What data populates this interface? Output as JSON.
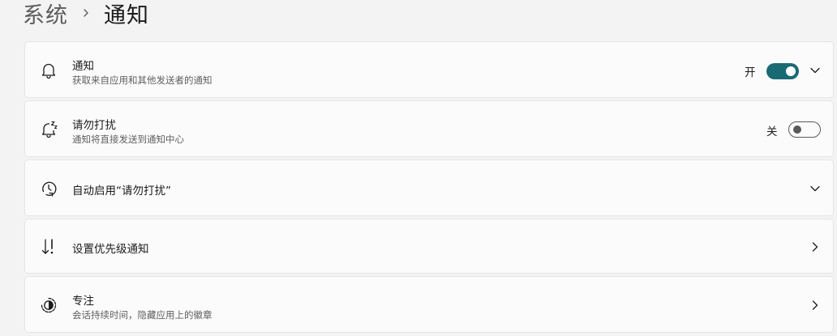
{
  "breadcrumb": {
    "parent": "系统",
    "current": "通知"
  },
  "cards": [
    {
      "title": "通知",
      "subtitle": "获取来自应用和其他发送者的通知",
      "icon": "bell-icon",
      "state_label": "开",
      "toggle_on": true,
      "trailing": "chevron-down-icon"
    },
    {
      "title": "请勿打扰",
      "subtitle": "通知将直接发送到通知中心",
      "icon": "bell-snooze-icon",
      "state_label": "关",
      "toggle_on": false
    },
    {
      "title": "自动启用“请勿打扰”",
      "icon": "clock-icon",
      "trailing": "chevron-down-icon"
    },
    {
      "title": "设置优先级通知",
      "icon": "priority-icon",
      "trailing": "chevron-right-icon"
    },
    {
      "title": "专注",
      "subtitle": "会话持续时间，隐藏应用上的徽章",
      "icon": "focus-icon",
      "trailing": "chevron-right-icon"
    }
  ],
  "colors": {
    "background": "#f3f3f3",
    "card": "#fbfbfb",
    "accent": "#1a6a74"
  }
}
